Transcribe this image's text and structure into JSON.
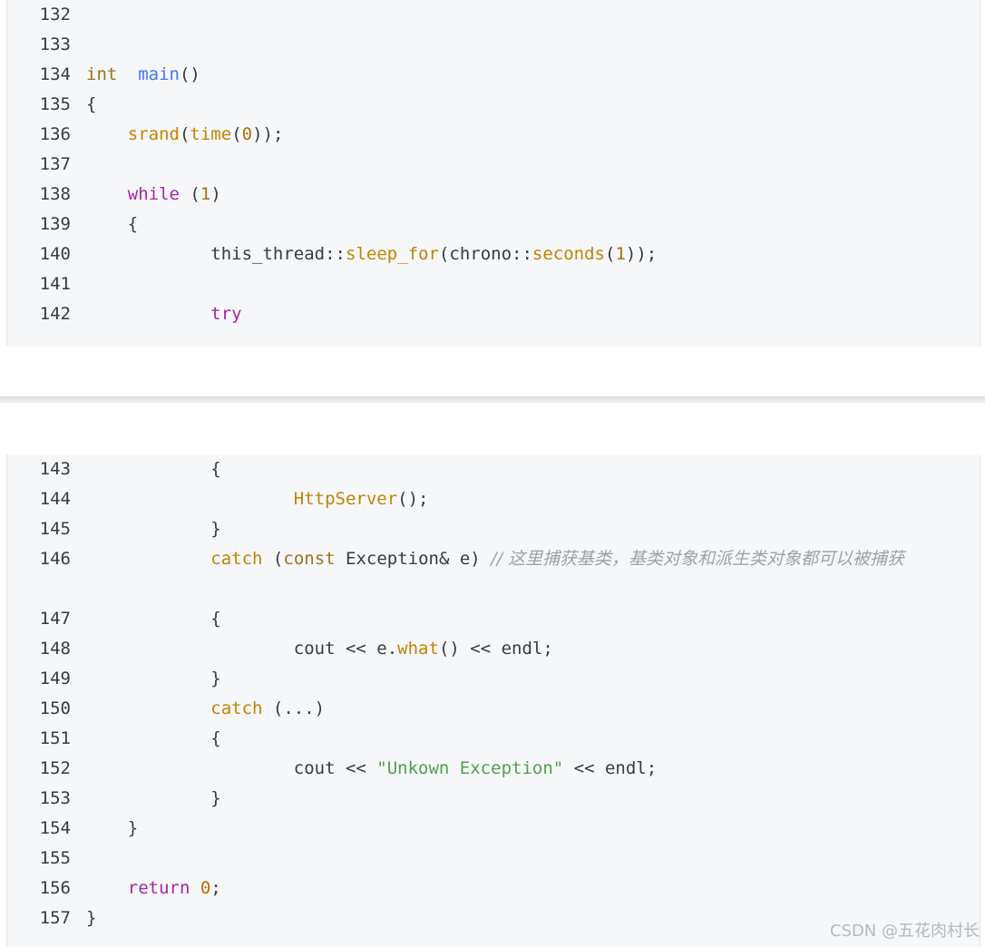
{
  "top_lines": [
    {
      "n": "132",
      "parts": []
    },
    {
      "n": "133",
      "parts": []
    },
    {
      "n": "134",
      "parts": [
        [
          "kw-type",
          "int"
        ],
        [
          "",
          "  "
        ],
        [
          "fn-def",
          "main"
        ],
        [
          "",
          "()"
        ]
      ]
    },
    {
      "n": "135",
      "parts": [
        [
          "",
          "{"
        ]
      ]
    },
    {
      "n": "136",
      "parts": [
        [
          "",
          "    "
        ],
        [
          "fn",
          "srand"
        ],
        [
          "",
          "("
        ],
        [
          "fn",
          "time"
        ],
        [
          "",
          "("
        ],
        [
          "num",
          "0"
        ],
        [
          "",
          "));"
        ]
      ]
    },
    {
      "n": "137",
      "parts": []
    },
    {
      "n": "138",
      "parts": [
        [
          "",
          "    "
        ],
        [
          "kw",
          "while"
        ],
        [
          "",
          " ("
        ],
        [
          "num",
          "1"
        ],
        [
          "",
          ")"
        ]
      ]
    },
    {
      "n": "139",
      "parts": [
        [
          "",
          "    {"
        ]
      ]
    },
    {
      "n": "140",
      "parts": [
        [
          "",
          "            this_thread::"
        ],
        [
          "fn",
          "sleep_for"
        ],
        [
          "",
          "(chrono::"
        ],
        [
          "fn",
          "seconds"
        ],
        [
          "",
          "("
        ],
        [
          "num",
          "1"
        ],
        [
          "",
          "));"
        ]
      ]
    },
    {
      "n": "141",
      "parts": []
    },
    {
      "n": "142",
      "parts": [
        [
          "",
          "            "
        ],
        [
          "kw",
          "try"
        ]
      ]
    }
  ],
  "bottom_lines": [
    {
      "n": "143",
      "parts": [
        [
          "",
          "            {"
        ]
      ]
    },
    {
      "n": "144",
      "parts": [
        [
          "",
          "                    "
        ],
        [
          "fn",
          "HttpServer"
        ],
        [
          "",
          "();"
        ]
      ]
    },
    {
      "n": "145",
      "parts": [
        [
          "",
          "            }"
        ]
      ]
    },
    {
      "n": "146",
      "wrap": true,
      "parts": [
        [
          "",
          "            "
        ],
        [
          "fn",
          "catch"
        ],
        [
          "",
          " ("
        ],
        [
          "kw-type",
          "const"
        ],
        [
          "",
          " Exception& e) "
        ],
        [
          "cmt",
          "// 这里捕获基类，基类对象和派生类对象都可以被捕获"
        ]
      ]
    },
    {
      "n": "147",
      "parts": [
        [
          "",
          "            {"
        ]
      ]
    },
    {
      "n": "148",
      "parts": [
        [
          "",
          "                    cout << e."
        ],
        [
          "fn",
          "what"
        ],
        [
          "",
          "() << endl;"
        ]
      ]
    },
    {
      "n": "149",
      "parts": [
        [
          "",
          "            }"
        ]
      ]
    },
    {
      "n": "150",
      "parts": [
        [
          "",
          "            "
        ],
        [
          "fn",
          "catch"
        ],
        [
          "",
          " (...)"
        ]
      ]
    },
    {
      "n": "151",
      "parts": [
        [
          "",
          "            {"
        ]
      ]
    },
    {
      "n": "152",
      "parts": [
        [
          "",
          "                    cout << "
        ],
        [
          "str",
          "\"Unkown Exception\""
        ],
        [
          "",
          " << endl;"
        ]
      ]
    },
    {
      "n": "153",
      "parts": [
        [
          "",
          "            }"
        ]
      ]
    },
    {
      "n": "154",
      "parts": [
        [
          "",
          "    }"
        ]
      ]
    },
    {
      "n": "155",
      "parts": []
    },
    {
      "n": "156",
      "parts": [
        [
          "",
          "    "
        ],
        [
          "kw",
          "return"
        ],
        [
          "",
          " "
        ],
        [
          "num",
          "0"
        ],
        [
          "",
          ";"
        ]
      ]
    },
    {
      "n": "157",
      "parts": [
        [
          "",
          "}"
        ]
      ]
    }
  ],
  "watermark": "CSDN @五花肉村长"
}
